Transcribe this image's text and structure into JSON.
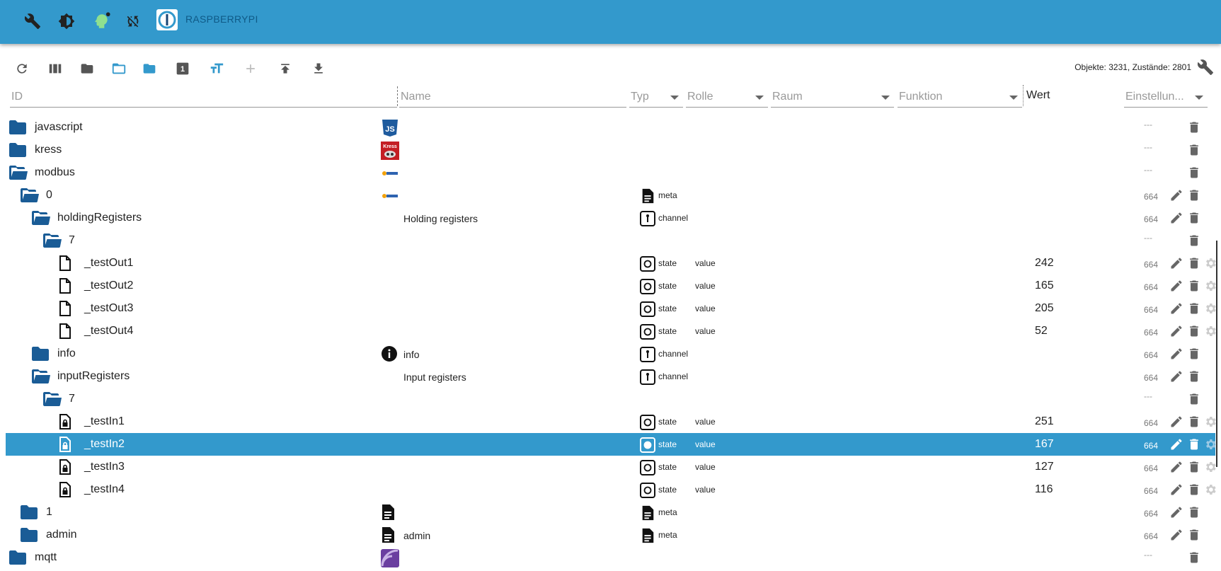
{
  "topbar": {
    "icons": [
      "wrench-icon",
      "brightness-icon",
      "expert-head-icon",
      "sync-off-icon"
    ],
    "hostname": "RASPBERRYPI",
    "color": "#3399cc"
  },
  "toolbar": {
    "buttons": [
      "refresh-icon",
      "columns-icon",
      "folder-closed-icon",
      "folder-open-icon",
      "folder-icon",
      "count-1-icon",
      "text-size-icon",
      "add-icon",
      "upload-icon",
      "download-icon"
    ],
    "stats": "Objekte: 3231, Zustände: 2801"
  },
  "columns": {
    "id": "ID",
    "name": "Name",
    "typ": "Typ",
    "rolle": "Rolle",
    "raum": "Raum",
    "funktion": "Funktion",
    "wert": "Wert",
    "settings": "Einstellun..."
  },
  "rows": [
    {
      "id": "javascript",
      "name": "",
      "type": "",
      "role": "",
      "value": "",
      "acl": "---",
      "icon": "folder-closed",
      "logo": "js-logo"
    },
    {
      "id": "kress",
      "name": "",
      "type": "",
      "role": "",
      "value": "",
      "acl": "---",
      "icon": "folder-closed",
      "logo": "kress-logo"
    },
    {
      "id": "modbus",
      "name": "",
      "type": "",
      "role": "",
      "value": "",
      "acl": "---",
      "icon": "folder-open",
      "logo": "modbus-logo"
    },
    {
      "id": "0",
      "name": "",
      "type": "meta",
      "role": "",
      "value": "",
      "acl": "664",
      "icon": "folder-open",
      "logo": "modbus-logo"
    },
    {
      "id": "holdingRegisters",
      "name": "Holding registers",
      "type": "channel",
      "role": "",
      "value": "",
      "acl": "664",
      "icon": "folder-open"
    },
    {
      "id": "7",
      "name": "",
      "type": "",
      "role": "",
      "value": "",
      "acl": "---",
      "icon": "folder-open"
    },
    {
      "id": "_testOut1",
      "name": "",
      "type": "state",
      "role": "value",
      "value": "242",
      "acl": "664",
      "icon": "file"
    },
    {
      "id": "_testOut2",
      "name": "",
      "type": "state",
      "role": "value",
      "value": "165",
      "acl": "664",
      "icon": "file"
    },
    {
      "id": "_testOut3",
      "name": "",
      "type": "state",
      "role": "value",
      "value": "205",
      "acl": "664",
      "icon": "file"
    },
    {
      "id": "_testOut4",
      "name": "",
      "type": "state",
      "role": "value",
      "value": "52",
      "acl": "664",
      "icon": "file"
    },
    {
      "id": "info",
      "name": "info",
      "type": "channel",
      "role": "",
      "value": "",
      "acl": "664",
      "icon": "folder-closed",
      "logo": "info-icon"
    },
    {
      "id": "inputRegisters",
      "name": "Input registers",
      "type": "channel",
      "role": "",
      "value": "",
      "acl": "664",
      "icon": "folder-open"
    },
    {
      "id": "7",
      "name": "",
      "type": "",
      "role": "",
      "value": "",
      "acl": "---",
      "icon": "folder-open"
    },
    {
      "id": "_testIn1",
      "name": "",
      "type": "state",
      "role": "value",
      "value": "251",
      "acl": "664",
      "icon": "file-lock"
    },
    {
      "id": "_testIn2",
      "name": "",
      "type": "state",
      "role": "value",
      "value": "167",
      "acl": "664",
      "icon": "file-lock",
      "selected": true
    },
    {
      "id": "_testIn3",
      "name": "",
      "type": "state",
      "role": "value",
      "value": "127",
      "acl": "664",
      "icon": "file-lock"
    },
    {
      "id": "_testIn4",
      "name": "",
      "type": "state",
      "role": "value",
      "value": "116",
      "acl": "664",
      "icon": "file-lock"
    },
    {
      "id": "1",
      "name": "",
      "type": "meta",
      "role": "",
      "value": "",
      "acl": "664",
      "icon": "folder-closed",
      "logo": "doc-icon"
    },
    {
      "id": "admin",
      "name": "admin",
      "type": "meta",
      "role": "",
      "value": "",
      "acl": "664",
      "icon": "folder-closed",
      "logo": "doc-icon"
    },
    {
      "id": "mqtt",
      "name": "",
      "type": "",
      "role": "",
      "value": "",
      "acl": "---",
      "icon": "folder-closed",
      "logo": "mqtt-logo"
    }
  ]
}
